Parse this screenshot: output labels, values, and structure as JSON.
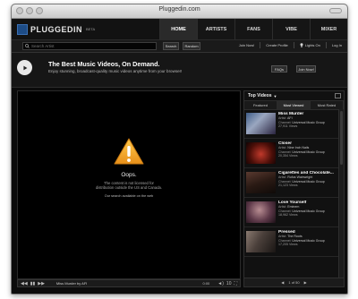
{
  "window": {
    "title": "Pluggedin.com"
  },
  "nav": {
    "logo": "PLUGGEDIN",
    "logo_beta": "BETA",
    "tabs": [
      "HOME",
      "ARTISTS",
      "FANS",
      "VIBE",
      "MIXER"
    ],
    "active_tab": "HOME"
  },
  "search": {
    "placeholder": "Search Artist",
    "buttons": {
      "search": "Search",
      "random": "Random"
    },
    "links": {
      "join_now": "Join Now!",
      "create_profile": "Create Profile",
      "lights_on": "Lights On",
      "log_in": "Log In"
    }
  },
  "hero": {
    "title": "The Best Music Videos, On Demand.",
    "subtitle": "Enjoy stunning, broadcast-quality music videos anytime from your browser!",
    "buttons": {
      "faqs": "FAQs",
      "join_now": "Join Now!"
    }
  },
  "player": {
    "oops": "Oops.",
    "message_line1": "The content is not licensed for",
    "message_line2": "distribution outside the US and Canada.",
    "link_text": "Our search available on the web",
    "controls": {
      "now_playing": "Miss Murder by AFI",
      "time": "0:00",
      "volume": "10"
    }
  },
  "sidebar": {
    "heading": "Top Videos",
    "tabs": [
      "Featured",
      "Most Viewed",
      "Most Rated"
    ],
    "active_tab": "Most Viewed",
    "footer": "1 of 50",
    "videos": [
      {
        "title": "Miss Murder",
        "artist": "AFI",
        "label": "Universal Music Group",
        "views": "27,911 Views"
      },
      {
        "title": "Closer",
        "artist": "Nine Inch Nails",
        "label": "Universal Music Group",
        "views": "20,354 Views"
      },
      {
        "title": "Cigarettes and Chocolate...",
        "artist": "Rufus Wainwright",
        "label": "Universal Music Group",
        "views": "21,123 Views"
      },
      {
        "title": "Love Yourself",
        "artist": "Eminem",
        "label": "Universal Music Group",
        "views": "18,962 Views"
      },
      {
        "title": "Pressed",
        "artist": "The Roots",
        "label": "Universal Music Group",
        "views": "17,205 Views"
      }
    ]
  },
  "colors": {
    "background": "#0b0b0b",
    "warning": "#f2a623",
    "accent": "#1d4c86"
  }
}
